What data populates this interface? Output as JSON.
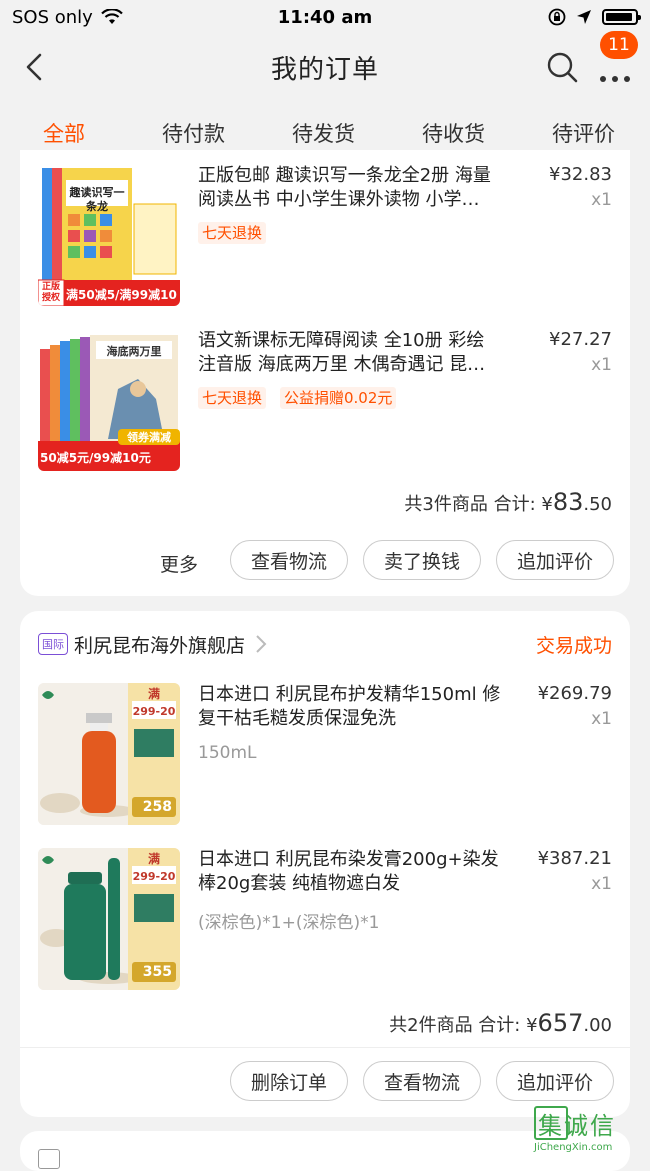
{
  "status_bar": {
    "carrier": "SOS only",
    "time": "11:40 am"
  },
  "nav": {
    "title": "我的订单",
    "badge": "11"
  },
  "tabs": [
    {
      "label": "全部",
      "active": true
    },
    {
      "label": "待付款"
    },
    {
      "label": "待发货"
    },
    {
      "label": "待收货"
    },
    {
      "label": "待评价"
    }
  ],
  "order1": {
    "items": [
      {
        "title_line1": "正版包邮 趣读识写一条龙全2册 海量",
        "title_line2": "阅读丛书 中小学生课外读物 小学…",
        "price": "¥32.83",
        "qty": "x1",
        "tag1": "七天退换",
        "thumb_caption1": "正版授权",
        "thumb_caption2": "满50减5/满99减10",
        "thumb_book": "趣读识写一条龙"
      },
      {
        "title_line1": "语文新课标无障碍阅读 全10册 彩绘",
        "title_line2": "注音版 海底两万里 木偶奇遇记 昆…",
        "price": "¥27.27",
        "qty": "x1",
        "tag1": "七天退换",
        "tag2": "公益捐赠0.02元",
        "thumb_book": "海底两万里",
        "thumb_caption1": "领券满减",
        "thumb_caption2": "50减5元/99减10元"
      }
    ],
    "total_prefix": "共3件商品 合计: ¥",
    "total_big": "83",
    "total_small": ".50",
    "more": "更多",
    "buttons": [
      "查看物流",
      "卖了换钱",
      "追加评价"
    ]
  },
  "order2": {
    "shop_tag": "国际",
    "shop_name": "利尻昆布海外旗舰店",
    "status": "交易成功",
    "items": [
      {
        "title_line1": "日本进口 利尻昆布护发精华150ml 修",
        "title_line2": "复干枯毛糙发质保湿免洗",
        "sub": "150mL",
        "price": "¥269.79",
        "qty": "x1",
        "thumb_man": "满",
        "thumb_promo": "299-20",
        "thumb_price": "258"
      },
      {
        "title_line1": "日本进口 利尻昆布染发膏200g+染发",
        "title_line2": "棒20g套装 纯植物遮白发",
        "sub": "(深棕色)*1+(深棕色)*1",
        "price": "¥387.21",
        "qty": "x1",
        "thumb_man": "满",
        "thumb_promo": "299-20",
        "thumb_price": "355"
      }
    ],
    "total_prefix": "共2件商品 合计: ¥",
    "total_big": "657",
    "total_small": ".00",
    "buttons": [
      "删除订单",
      "查看物流",
      "追加评价"
    ]
  },
  "watermark": {
    "chars": "集诚信",
    "url": "JiChengXin.com"
  }
}
